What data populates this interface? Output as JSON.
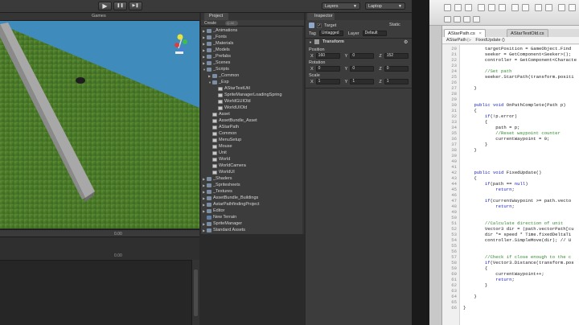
{
  "toolbar": {
    "play_icon": "play-icon",
    "pause_icon": "pause-icon",
    "step_icon": "step-icon",
    "play_glyph": "▶",
    "pause_glyph": "❚❚",
    "step_glyph": "▶❚",
    "layers_label": "Layers",
    "layout_label": "Laptop"
  },
  "game": {
    "tab_label": "Games",
    "ground_color": "#4f7a2c",
    "sky_color": "#3f8cbc",
    "lower_value": "0.00",
    "lower_value2": "0.00"
  },
  "project": {
    "tab_label": "Project",
    "create_label": "Create",
    "search_placeholder": "Q-All",
    "items": [
      {
        "label": "_Animations",
        "type": "folder",
        "depth": 0,
        "expanded": false
      },
      {
        "label": "_Fonts",
        "type": "folder",
        "depth": 0,
        "expanded": false
      },
      {
        "label": "_Materials",
        "type": "folder",
        "depth": 0,
        "expanded": false
      },
      {
        "label": "_Models",
        "type": "folder",
        "depth": 0,
        "expanded": false
      },
      {
        "label": "_Prefabs",
        "type": "folder",
        "depth": 0,
        "expanded": false
      },
      {
        "label": "_Scenes",
        "type": "folder",
        "depth": 0,
        "expanded": false
      },
      {
        "label": "_Scripts",
        "type": "folder",
        "depth": 0,
        "expanded": true
      },
      {
        "label": "_Common",
        "type": "folder",
        "depth": 1,
        "expanded": false
      },
      {
        "label": "_Exp",
        "type": "folder",
        "depth": 1,
        "expanded": true
      },
      {
        "label": "AStarTestUtil",
        "type": "script",
        "depth": 2
      },
      {
        "label": "SpriteManagerLoadingSpring",
        "type": "script",
        "depth": 2
      },
      {
        "label": "WorldGUIOld",
        "type": "script",
        "depth": 2
      },
      {
        "label": "WorldUIOld",
        "type": "script",
        "depth": 2
      },
      {
        "label": "Asset",
        "type": "script",
        "depth": 1
      },
      {
        "label": "AssetBundle_Asset",
        "type": "script",
        "depth": 1
      },
      {
        "label": "AStarPath",
        "type": "script",
        "depth": 1
      },
      {
        "label": "Common",
        "type": "script",
        "depth": 1
      },
      {
        "label": "MenuSetup",
        "type": "script",
        "depth": 1
      },
      {
        "label": "Mouse",
        "type": "script",
        "depth": 1
      },
      {
        "label": "Unit",
        "type": "script",
        "depth": 1
      },
      {
        "label": "World",
        "type": "script",
        "depth": 1
      },
      {
        "label": "WorldCamera",
        "type": "script",
        "depth": 1
      },
      {
        "label": "WorldUI",
        "type": "script",
        "depth": 1
      },
      {
        "label": "_Shaders",
        "type": "folder",
        "depth": 0,
        "expanded": false
      },
      {
        "label": "_Spritesheets",
        "type": "folder",
        "depth": 0,
        "expanded": false
      },
      {
        "label": "_Textures",
        "type": "folder",
        "depth": 0,
        "expanded": false
      },
      {
        "label": "AssetBundle_Buildings",
        "type": "folder",
        "depth": 0,
        "expanded": false
      },
      {
        "label": "AstarPathfindingProject",
        "type": "folder",
        "depth": 0,
        "expanded": false
      },
      {
        "label": "Editor",
        "type": "folder",
        "depth": 0,
        "expanded": false
      },
      {
        "label": "New Terrain",
        "type": "prefab",
        "depth": 0
      },
      {
        "label": "SpriteManager",
        "type": "folder",
        "depth": 0,
        "expanded": false
      },
      {
        "label": "Standard Assets",
        "type": "folder",
        "depth": 0,
        "expanded": false
      }
    ]
  },
  "inspector": {
    "tab_label": "Inspector",
    "object_name": "Target",
    "static_label": "Static",
    "tag_label": "Tag",
    "tag_value": "Untagged",
    "layer_label": "Layer",
    "layer_value": "Default",
    "component_title": "Transform",
    "position_label": "Position",
    "rotation_label": "Rotation",
    "scale_label": "Scale",
    "position": {
      "x": "160",
      "y": "0",
      "z": "152"
    },
    "rotation": {
      "x": "0",
      "y": "0",
      "z": "0"
    },
    "scale": {
      "x": "1",
      "y": "1",
      "z": "1"
    },
    "axis_x": "X",
    "axis_y": "Y",
    "axis_z": "Z"
  },
  "editor": {
    "tabs": [
      {
        "label": "AStarPath.cs",
        "active": true
      },
      {
        "label": "AStarTestOld.cs",
        "active": false
      }
    ],
    "breadcrumb_class": "AStarPath ▷",
    "breadcrumb_method": "FixedUpdate ()",
    "lines": [
      {
        "n": "20",
        "code": "        targetPosition = GameObject.Find"
      },
      {
        "n": "21",
        "code": "        seeker = GetComponent<Seeker>();"
      },
      {
        "n": "22",
        "code": "        controller = GetComponent<Characte"
      },
      {
        "n": "23",
        "code": ""
      },
      {
        "n": "24",
        "code": "        //Set path"
      },
      {
        "n": "25",
        "code": "        seeker.StartPath(transform.positi"
      },
      {
        "n": "26",
        "code": ""
      },
      {
        "n": "27",
        "code": "    }"
      },
      {
        "n": "28",
        "code": ""
      },
      {
        "n": "29",
        "code": ""
      },
      {
        "n": "30",
        "code": "    public void OnPathComplete(Path p)"
      },
      {
        "n": "31",
        "code": "    {"
      },
      {
        "n": "32",
        "code": "        if(!p.error)"
      },
      {
        "n": "33",
        "code": "        {"
      },
      {
        "n": "34",
        "code": "            path = p;"
      },
      {
        "n": "35",
        "code": "            //Reset waypoint counter"
      },
      {
        "n": "36",
        "code": "            currentWaypoint = 0;"
      },
      {
        "n": "37",
        "code": "        }"
      },
      {
        "n": "38",
        "code": "    }"
      },
      {
        "n": "39",
        "code": ""
      },
      {
        "n": "40",
        "code": ""
      },
      {
        "n": "41",
        "code": ""
      },
      {
        "n": "42",
        "code": "    public void FixedUpdate()"
      },
      {
        "n": "43",
        "code": "    {"
      },
      {
        "n": "44",
        "code": "        if(path == null)"
      },
      {
        "n": "45",
        "code": "            return;"
      },
      {
        "n": "46",
        "code": ""
      },
      {
        "n": "47",
        "code": "        if(currentWaypoint >= path.vecto"
      },
      {
        "n": "48",
        "code": "            return;"
      },
      {
        "n": "49",
        "code": ""
      },
      {
        "n": "50",
        "code": ""
      },
      {
        "n": "51",
        "code": "        //Calculate direction of unit"
      },
      {
        "n": "52",
        "code": "        Vector3 dir = (path.vectorPath[cu"
      },
      {
        "n": "53",
        "code": "        dir *= speed * Time.fixedDeltaTi"
      },
      {
        "n": "54",
        "code": "        controller.SimpleMove(dir); // U"
      },
      {
        "n": "55",
        "code": ""
      },
      {
        "n": "56",
        "code": ""
      },
      {
        "n": "57",
        "code": "        //Check if close enough to the c"
      },
      {
        "n": "58",
        "code": "        if(Vector3.Distance(transform.pos"
      },
      {
        "n": "59",
        "code": "        {"
      },
      {
        "n": "60",
        "code": "            currentWaypoint++;"
      },
      {
        "n": "61",
        "code": "            return;"
      },
      {
        "n": "62",
        "code": "        }"
      },
      {
        "n": "63",
        "code": ""
      },
      {
        "n": "64",
        "code": "    }"
      },
      {
        "n": "65",
        "code": ""
      },
      {
        "n": "66",
        "code": "}"
      }
    ],
    "keyword_color": "#1b27c4",
    "comment_color": "#2f8a2f"
  }
}
